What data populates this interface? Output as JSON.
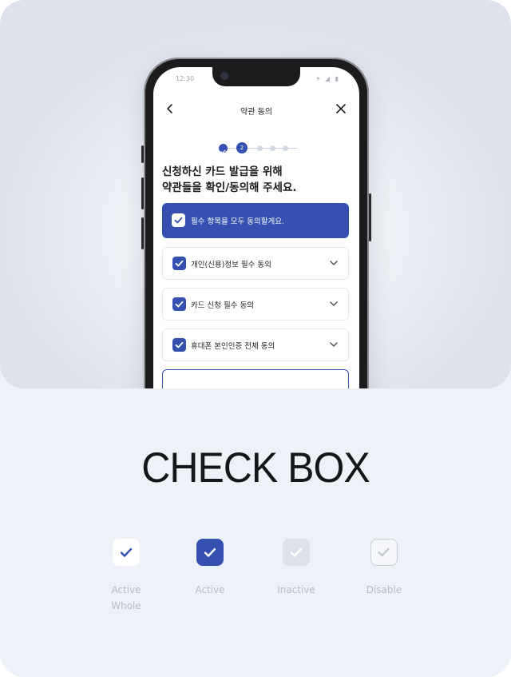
{
  "phone": {
    "status": {
      "time": "12:30",
      "icons": "▾ ◢ ▮"
    },
    "nav": {
      "title": "약관 동의",
      "back_icon": "chevron-left-icon",
      "close_icon": "close-icon"
    },
    "stepper": {
      "current": "2",
      "total_steps": 5
    },
    "headline": {
      "line1": "신청하신 카드 발급을 위해",
      "line2": "약관들을 확인/동의해 주세요."
    },
    "agree_all": {
      "label": "필수 항목을 모두 동의할게요.",
      "checked": true
    },
    "items": [
      {
        "label": "개인(신용)정보 필수 동의",
        "checked": true
      },
      {
        "label": "카드 신청 필수 동의",
        "checked": true
      },
      {
        "label": "휴대폰 본인인증 전체 동의",
        "checked": true
      }
    ]
  },
  "title": "CHECK BOX",
  "samples": [
    {
      "label1": "Active",
      "label2": "Whole",
      "bg": "#ffffff",
      "check": "#3550b0",
      "border": "#ffffff"
    },
    {
      "label1": "Active",
      "label2": "",
      "bg": "#3550b0",
      "check": "#ffffff",
      "border": "#3550b0"
    },
    {
      "label1": "Inactive",
      "label2": "",
      "bg": "#dde1ea",
      "check": "#ffffff",
      "border": "#dde1ea"
    },
    {
      "label1": "Disable",
      "label2": "",
      "bg": "#f4f6fa",
      "check": "#c3c7d0",
      "border": "#c9cdd6"
    }
  ],
  "colors": {
    "accent": "#3550b0",
    "title": "#15161a",
    "muted": "#b6bac4"
  }
}
